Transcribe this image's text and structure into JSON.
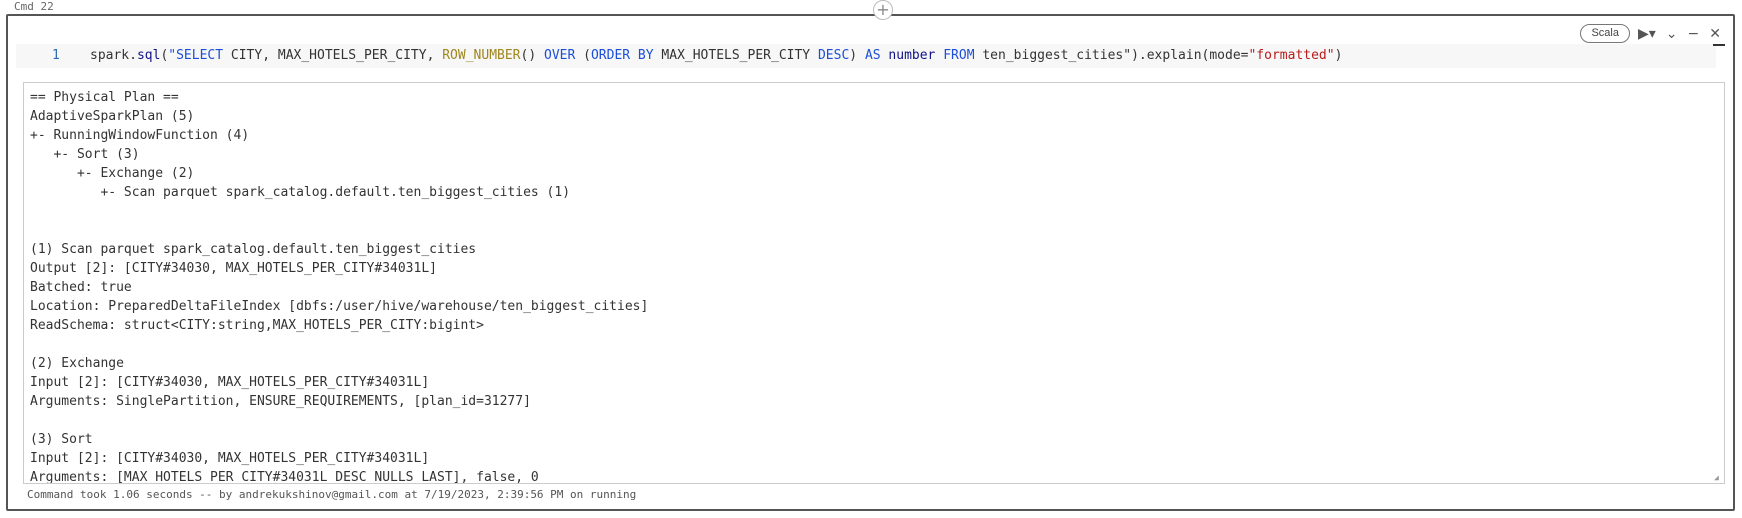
{
  "cmd_label": "Cmd 22",
  "add_icon": "plus-icon",
  "toolbar": {
    "language": "Scala",
    "icons": [
      "run-icon",
      "dropdown-icon",
      "collapse-icon",
      "minimize-icon",
      "close-icon"
    ]
  },
  "editor": {
    "line_number": "1",
    "code_parts": [
      {
        "t": "spark.",
        "c": ""
      },
      {
        "t": "sql",
        "c": "num"
      },
      {
        "t": "(",
        "c": ""
      },
      {
        "t": "\"SELECT",
        "c": "kw"
      },
      {
        "t": " CITY, MAX_HOTELS_PER_CITY, ",
        "c": ""
      },
      {
        "t": "ROW_NUMBER",
        "c": "fn"
      },
      {
        "t": "() ",
        "c": ""
      },
      {
        "t": "OVER",
        "c": "kw"
      },
      {
        "t": " (",
        "c": ""
      },
      {
        "t": "ORDER BY",
        "c": "kw"
      },
      {
        "t": " MAX_HOTELS_PER_CITY ",
        "c": ""
      },
      {
        "t": "DESC",
        "c": "kw"
      },
      {
        "t": ") ",
        "c": ""
      },
      {
        "t": "AS",
        "c": "kw"
      },
      {
        "t": " number ",
        "c": "num"
      },
      {
        "t": "FROM",
        "c": "kw"
      },
      {
        "t": " ten_biggest_cities\"",
        "c": ""
      },
      {
        "t": ").explain(mode=",
        "c": ""
      },
      {
        "t": "\"formatted\"",
        "c": "str"
      },
      {
        "t": ")",
        "c": ""
      }
    ]
  },
  "output_lines": [
    "== Physical Plan ==",
    "AdaptiveSparkPlan (5)",
    "+- RunningWindowFunction (4)",
    "   +- Sort (3)",
    "      +- Exchange (2)",
    "         +- Scan parquet spark_catalog.default.ten_biggest_cities (1)",
    "",
    "",
    "(1) Scan parquet spark_catalog.default.ten_biggest_cities",
    "Output [2]: [CITY#34030, MAX_HOTELS_PER_CITY#34031L]",
    "Batched: true",
    "Location: PreparedDeltaFileIndex [dbfs:/user/hive/warehouse/ten_biggest_cities]",
    "ReadSchema: struct<CITY:string,MAX_HOTELS_PER_CITY:bigint>",
    "",
    "(2) Exchange",
    "Input [2]: [CITY#34030, MAX_HOTELS_PER_CITY#34031L]",
    "Arguments: SinglePartition, ENSURE_REQUIREMENTS, [plan_id=31277]",
    "",
    "(3) Sort",
    "Input [2]: [CITY#34030, MAX_HOTELS_PER_CITY#34031L]",
    "Arguments: [MAX_HOTELS_PER_CITY#34031L DESC NULLS LAST], false, 0"
  ],
  "footer": "Command took 1.06 seconds -- by andrekukshinov@gmail.com at 7/19/2023, 2:39:56 PM on running"
}
